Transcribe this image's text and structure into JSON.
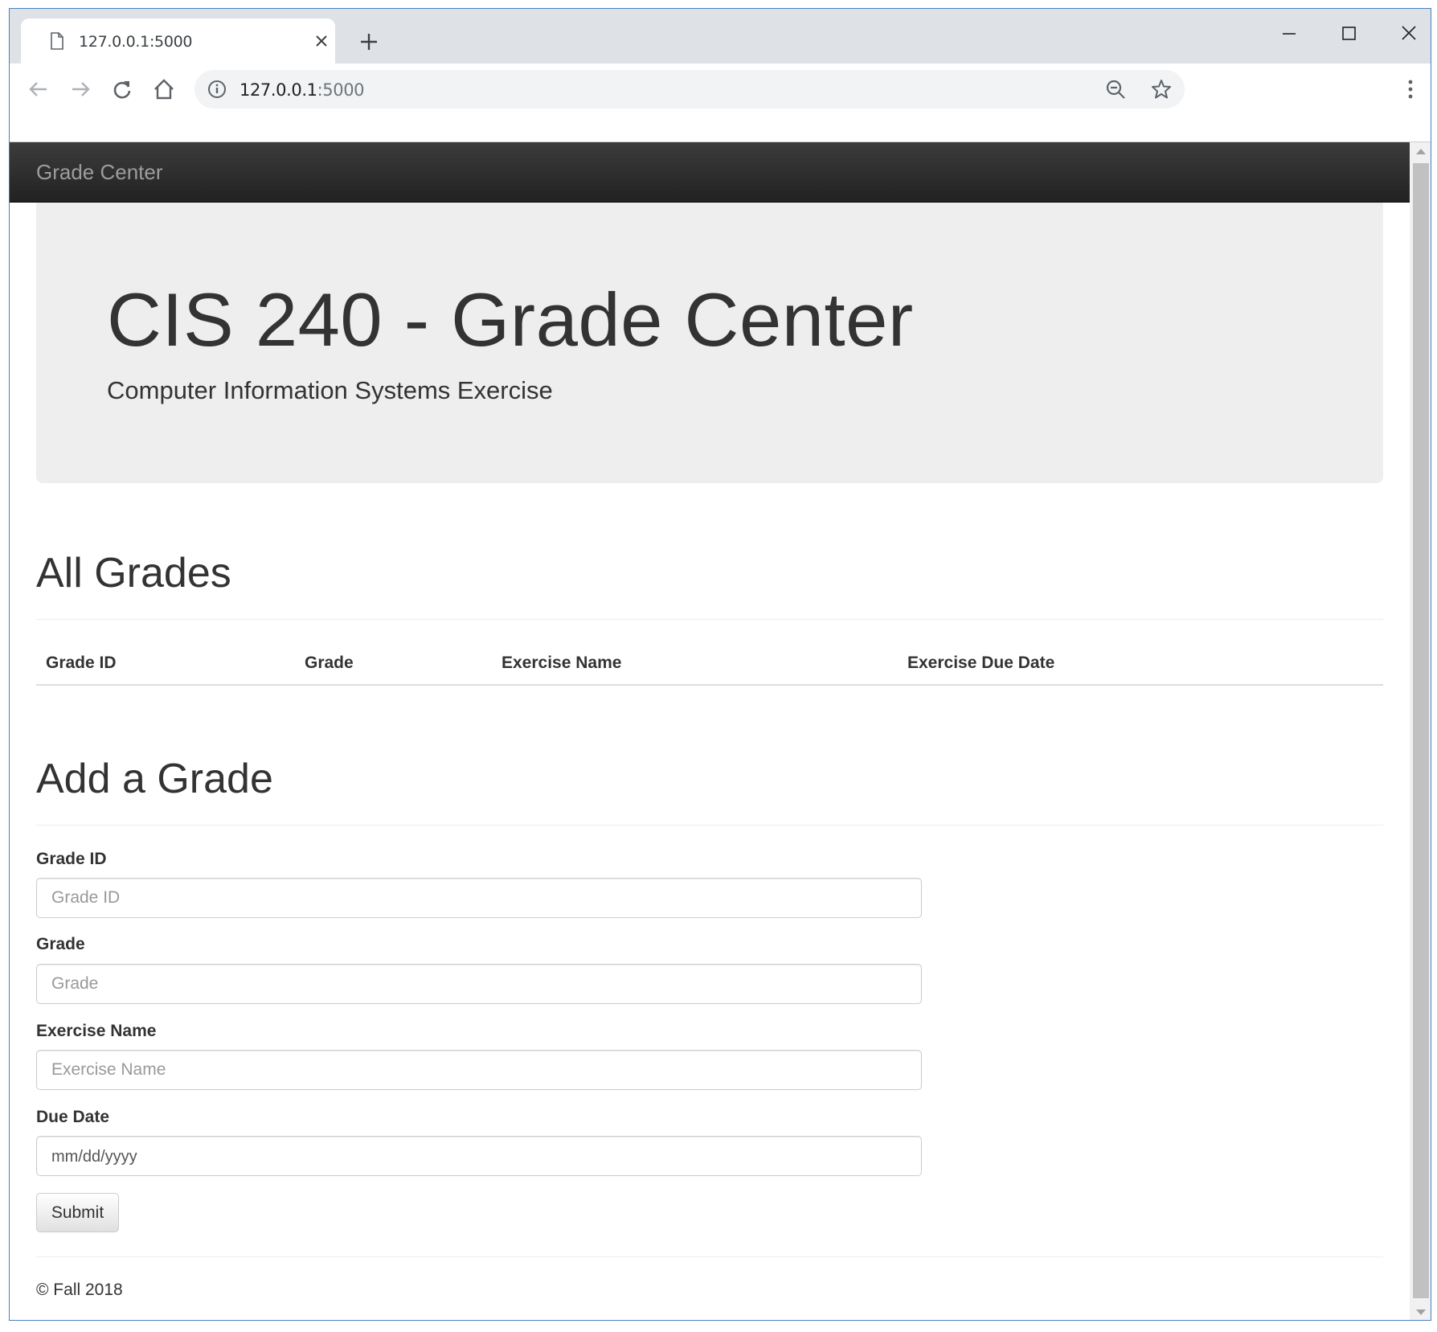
{
  "browser": {
    "tab_title": "127.0.0.1:5000",
    "url_host": "127.0.0.1",
    "url_port": ":5000"
  },
  "navbar": {
    "brand": "Grade Center"
  },
  "jumbotron": {
    "title": "CIS 240 - Grade Center",
    "subtitle": "Computer Information Systems Exercise"
  },
  "all_grades": {
    "heading": "All Grades",
    "columns": [
      "Grade ID",
      "Grade",
      "Exercise Name",
      "Exercise Due Date"
    ]
  },
  "add_grade": {
    "heading": "Add a Grade",
    "fields": [
      {
        "label": "Grade ID",
        "placeholder": "Grade ID"
      },
      {
        "label": "Grade",
        "placeholder": "Grade"
      },
      {
        "label": "Exercise Name",
        "placeholder": "Exercise Name"
      },
      {
        "label": "Due Date",
        "placeholder": "mm/dd/yyyy"
      }
    ],
    "submit_label": "Submit"
  },
  "footer": {
    "text": "© Fall 2018"
  }
}
